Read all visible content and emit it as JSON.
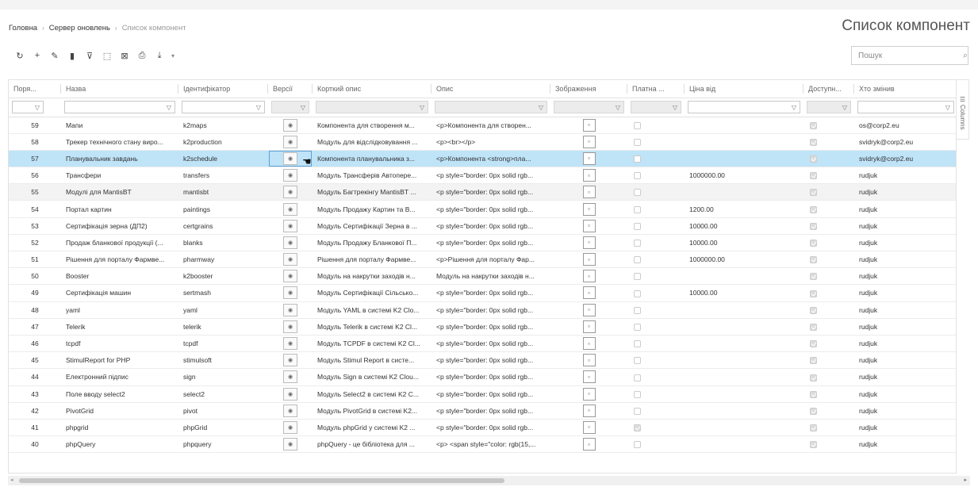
{
  "breadcrumb": {
    "home": "Головна",
    "parent": "Сервер оновлень",
    "current": "Список компонент"
  },
  "page_title": "Список компонент",
  "search": {
    "placeholder": "Пошук",
    "value": ""
  },
  "columns": [
    "Поря...",
    "Назва",
    "Ідентифікатор",
    "Версії",
    "Корткий опис",
    "Опис",
    "Зображення",
    "Платна ...",
    "Ціна від",
    "Доступн...",
    "Хто змінив"
  ],
  "columns_panel_label": "Columns",
  "rows": [
    {
      "order": "59",
      "name": "Мапи",
      "ident": "k2maps",
      "short": "Компонента для створення м...",
      "desc": "<p>Компонента для створен...",
      "paid": false,
      "price": "",
      "avail": true,
      "changed": "os@corp2.eu"
    },
    {
      "order": "58",
      "name": "Трекер технічного стану виро...",
      "ident": "k2production",
      "short": "Модуль для відслідковування ...",
      "desc": "<p><br></p>",
      "paid": false,
      "price": "",
      "avail": true,
      "changed": "svidryk@corp2.eu"
    },
    {
      "order": "57",
      "name": "Планувальник завдань",
      "ident": "k2schedule",
      "short": "Компонента планувальника з...",
      "desc": "<p>Компонента <strong>пла...",
      "paid": false,
      "price": "",
      "avail": true,
      "changed": "svidryk@corp2.eu"
    },
    {
      "order": "56",
      "name": "Трансфери",
      "ident": "transfers",
      "short": "Модуль Трансферів Автопере...",
      "desc": "<p style=\"border: 0px solid rgb...",
      "paid": false,
      "price": "1000000.00",
      "avail": true,
      "changed": "rudjuk"
    },
    {
      "order": "55",
      "name": "Модулі для MantisBT",
      "ident": "mantisbt",
      "short": "Модуль Багтрекінгу MantisBT ...",
      "desc": "<p style=\"border: 0px solid rgb...",
      "paid": false,
      "price": "",
      "avail": true,
      "changed": "rudjuk"
    },
    {
      "order": "54",
      "name": "Портал картин",
      "ident": "paintings",
      "short": "Модуль Продажу Картин та В...",
      "desc": "<p style=\"border: 0px solid rgb...",
      "paid": false,
      "price": "1200.00",
      "avail": true,
      "changed": "rudjuk"
    },
    {
      "order": "53",
      "name": "Сертифікація зерна (ДП2)",
      "ident": "certgrains",
      "short": "Модуль Сертифікації Зерна в ...",
      "desc": "<p style=\"border: 0px solid rgb...",
      "paid": false,
      "price": "10000.00",
      "avail": true,
      "changed": "rudjuk"
    },
    {
      "order": "52",
      "name": "Продаж бланкової продукції (...",
      "ident": "blanks",
      "short": "Модуль Продажу Бланкової П...",
      "desc": "<p style=\"border: 0px solid rgb...",
      "paid": false,
      "price": "10000.00",
      "avail": true,
      "changed": "rudjuk"
    },
    {
      "order": "51",
      "name": "Рішення для порталу Фармве...",
      "ident": "pharmway",
      "short": "Рішення для порталу Фармве...",
      "desc": "<p>Рішення для порталу Фар...",
      "paid": false,
      "price": "1000000.00",
      "avail": true,
      "changed": "rudjuk"
    },
    {
      "order": "50",
      "name": "Booster",
      "ident": "k2booster",
      "short": "Модуль на накрутки заходів н...",
      "desc": "Модуль на накрутки заходів н...",
      "paid": false,
      "price": "",
      "avail": true,
      "changed": "rudjuk"
    },
    {
      "order": "49",
      "name": "Сертифікація машин",
      "ident": "sertmash",
      "short": "Модуль Сертифікації Сільсько...",
      "desc": "<p style=\"border: 0px solid rgb...",
      "paid": false,
      "price": "10000.00",
      "avail": true,
      "changed": "rudjuk"
    },
    {
      "order": "48",
      "name": "yaml",
      "ident": "yaml",
      "short": "Модуль YAML в системі K2 Clo...",
      "desc": "<p style=\"border: 0px solid rgb...",
      "paid": false,
      "price": "",
      "avail": true,
      "changed": "rudjuk"
    },
    {
      "order": "47",
      "name": "Telerik",
      "ident": "telerik",
      "short": "Модуль Telerik в системі K2 Cl...",
      "desc": "<p style=\"border: 0px solid rgb...",
      "paid": false,
      "price": "",
      "avail": true,
      "changed": "rudjuk"
    },
    {
      "order": "46",
      "name": "tcpdf",
      "ident": "tcpdf",
      "short": "Модуль TCPDF в системі K2 Cl...",
      "desc": "<p style=\"border: 0px solid rgb...",
      "paid": false,
      "price": "",
      "avail": true,
      "changed": "rudjuk"
    },
    {
      "order": "45",
      "name": "StimulReport for PHP",
      "ident": "stimulsoft",
      "short": "Модуль Stimul Report в систе...",
      "desc": "<p style=\"border: 0px solid rgb...",
      "paid": false,
      "price": "",
      "avail": true,
      "changed": "rudjuk"
    },
    {
      "order": "44",
      "name": "Електронний підпис",
      "ident": "sign",
      "short": "Модуль Sign в системі K2 Clou...",
      "desc": "<p style=\"border: 0px solid rgb...",
      "paid": false,
      "price": "",
      "avail": true,
      "changed": "rudjuk"
    },
    {
      "order": "43",
      "name": "Поле вводу select2",
      "ident": "select2",
      "short": "Модуль Select2 в системі K2 C...",
      "desc": "<p style=\"border: 0px solid rgb...",
      "paid": false,
      "price": "",
      "avail": true,
      "changed": "rudjuk"
    },
    {
      "order": "42",
      "name": "PivotGrid",
      "ident": "pivot",
      "short": "Модуль PivotGrid в системі K2...",
      "desc": "<p style=\"border: 0px solid rgb...",
      "paid": false,
      "price": "",
      "avail": true,
      "changed": "rudjuk"
    },
    {
      "order": "41",
      "name": "phpgrid",
      "ident": "phpGrid",
      "short": "Модуль phpGrid у системі K2 ...",
      "desc": "<p style=\"border: 0px solid rgb...",
      "paid": true,
      "price": "",
      "avail": true,
      "changed": "rudjuk"
    },
    {
      "order": "40",
      "name": "phpQuery",
      "ident": "phpquery",
      "short": "phpQuery - це бібліотека для ...",
      "desc": "<p> <span style=\"color: rgb(15,...",
      "paid": false,
      "price": "",
      "avail": true,
      "changed": "rudjuk"
    }
  ],
  "selected_row": 2,
  "hover_row": 4,
  "colors": {
    "selected_row": "#bfe3f7",
    "hover_row": "#f3f3f3",
    "border": "#e2e2e2"
  },
  "icons": {
    "version": "eye-icon",
    "image": "image-icon",
    "filter": "funnel-icon"
  }
}
